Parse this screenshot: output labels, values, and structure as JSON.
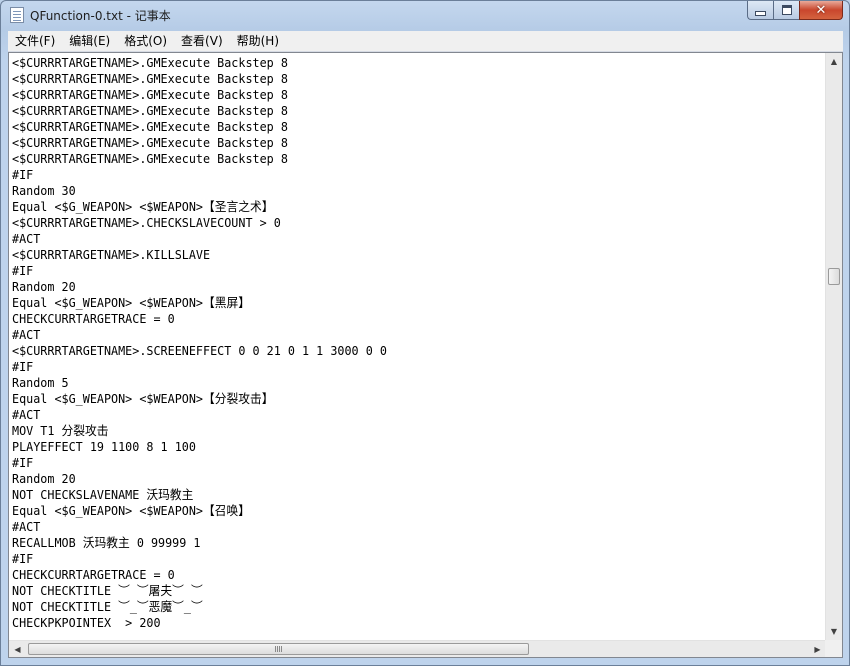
{
  "window": {
    "title": "QFunction-0.txt - 记事本"
  },
  "caption_buttons": {
    "minimize": "minimize",
    "maximize": "maximize",
    "close": "✕"
  },
  "menu": {
    "items": [
      {
        "label": "文件(F)"
      },
      {
        "label": "编辑(E)"
      },
      {
        "label": "格式(O)"
      },
      {
        "label": "查看(V)"
      },
      {
        "label": "帮助(H)"
      }
    ]
  },
  "editor": {
    "lines": [
      "<$CURRRTARGETNAME>.GMExecute Backstep 8",
      "<$CURRRTARGETNAME>.GMExecute Backstep 8",
      "<$CURRRTARGETNAME>.GMExecute Backstep 8",
      "<$CURRRTARGETNAME>.GMExecute Backstep 8",
      "<$CURRRTARGETNAME>.GMExecute Backstep 8",
      "<$CURRRTARGETNAME>.GMExecute Backstep 8",
      "<$CURRRTARGETNAME>.GMExecute Backstep 8",
      "#IF",
      "Random 30",
      "Equal <$G_WEAPON> <$WEAPON>【圣言之术】",
      "<$CURRRTARGETNAME>.CHECKSLAVECOUNT > 0",
      "#ACT",
      "<$CURRRTARGETNAME>.KILLSLAVE",
      "#IF",
      "Random 20",
      "Equal <$G_WEAPON> <$WEAPON>【黑屏】",
      "CHECKCURRTARGETRACE = 0",
      "#ACT",
      "<$CURRRTARGETNAME>.SCREENEFFECT 0 0 21 0 1 1 3000 0 0",
      "#IF",
      "Random 5",
      "Equal <$G_WEAPON> <$WEAPON>【分裂攻击】",
      "#ACT",
      "MOV T1 分裂攻击",
      "PLAYEFFECT 19 1100 8 1 100",
      "#IF",
      "Random 20",
      "NOT CHECKSLAVENAME 沃玛教主",
      "Equal <$G_WEAPON> <$WEAPON>【召唤】",
      "#ACT",
      "RECALLMOB 沃玛教主 0 99999 1",
      "#IF",
      "CHECKCURRTARGETRACE = 0",
      "NOT CHECKTITLE ︶ ︶屠夫︶ ︶",
      "NOT CHECKTITLE ︶_︶恶魔︶_︶",
      "CHECKPKPOINTEX  > 200"
    ]
  },
  "scrollbars": {
    "vertical": {
      "position": 0.37,
      "up_glyph": "▲",
      "down_glyph": "▼"
    },
    "horizontal": {
      "position": 0.0,
      "left_glyph": "◀",
      "right_glyph": "▶"
    }
  }
}
